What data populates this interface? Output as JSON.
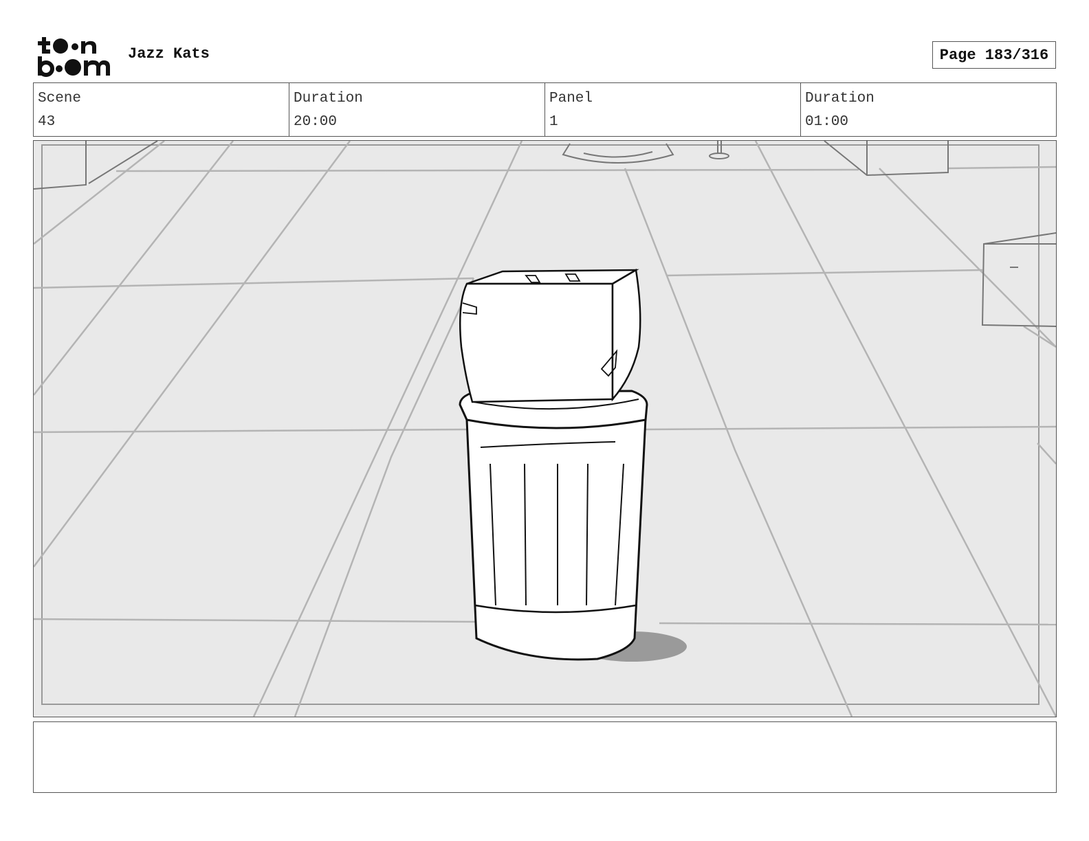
{
  "header": {
    "project_title": "Jazz Kats",
    "page_label": "Page 183/316"
  },
  "info": {
    "scene_label": "Scene",
    "scene_value": "43",
    "scene_duration_label": "Duration",
    "scene_duration_value": "20:00",
    "panel_label": "Panel",
    "panel_value": "1",
    "panel_duration_label": "Duration",
    "panel_duration_value": "01:00"
  },
  "notes": {
    "text": ""
  },
  "icons": {
    "logo": "toonboom-logo-icon"
  }
}
